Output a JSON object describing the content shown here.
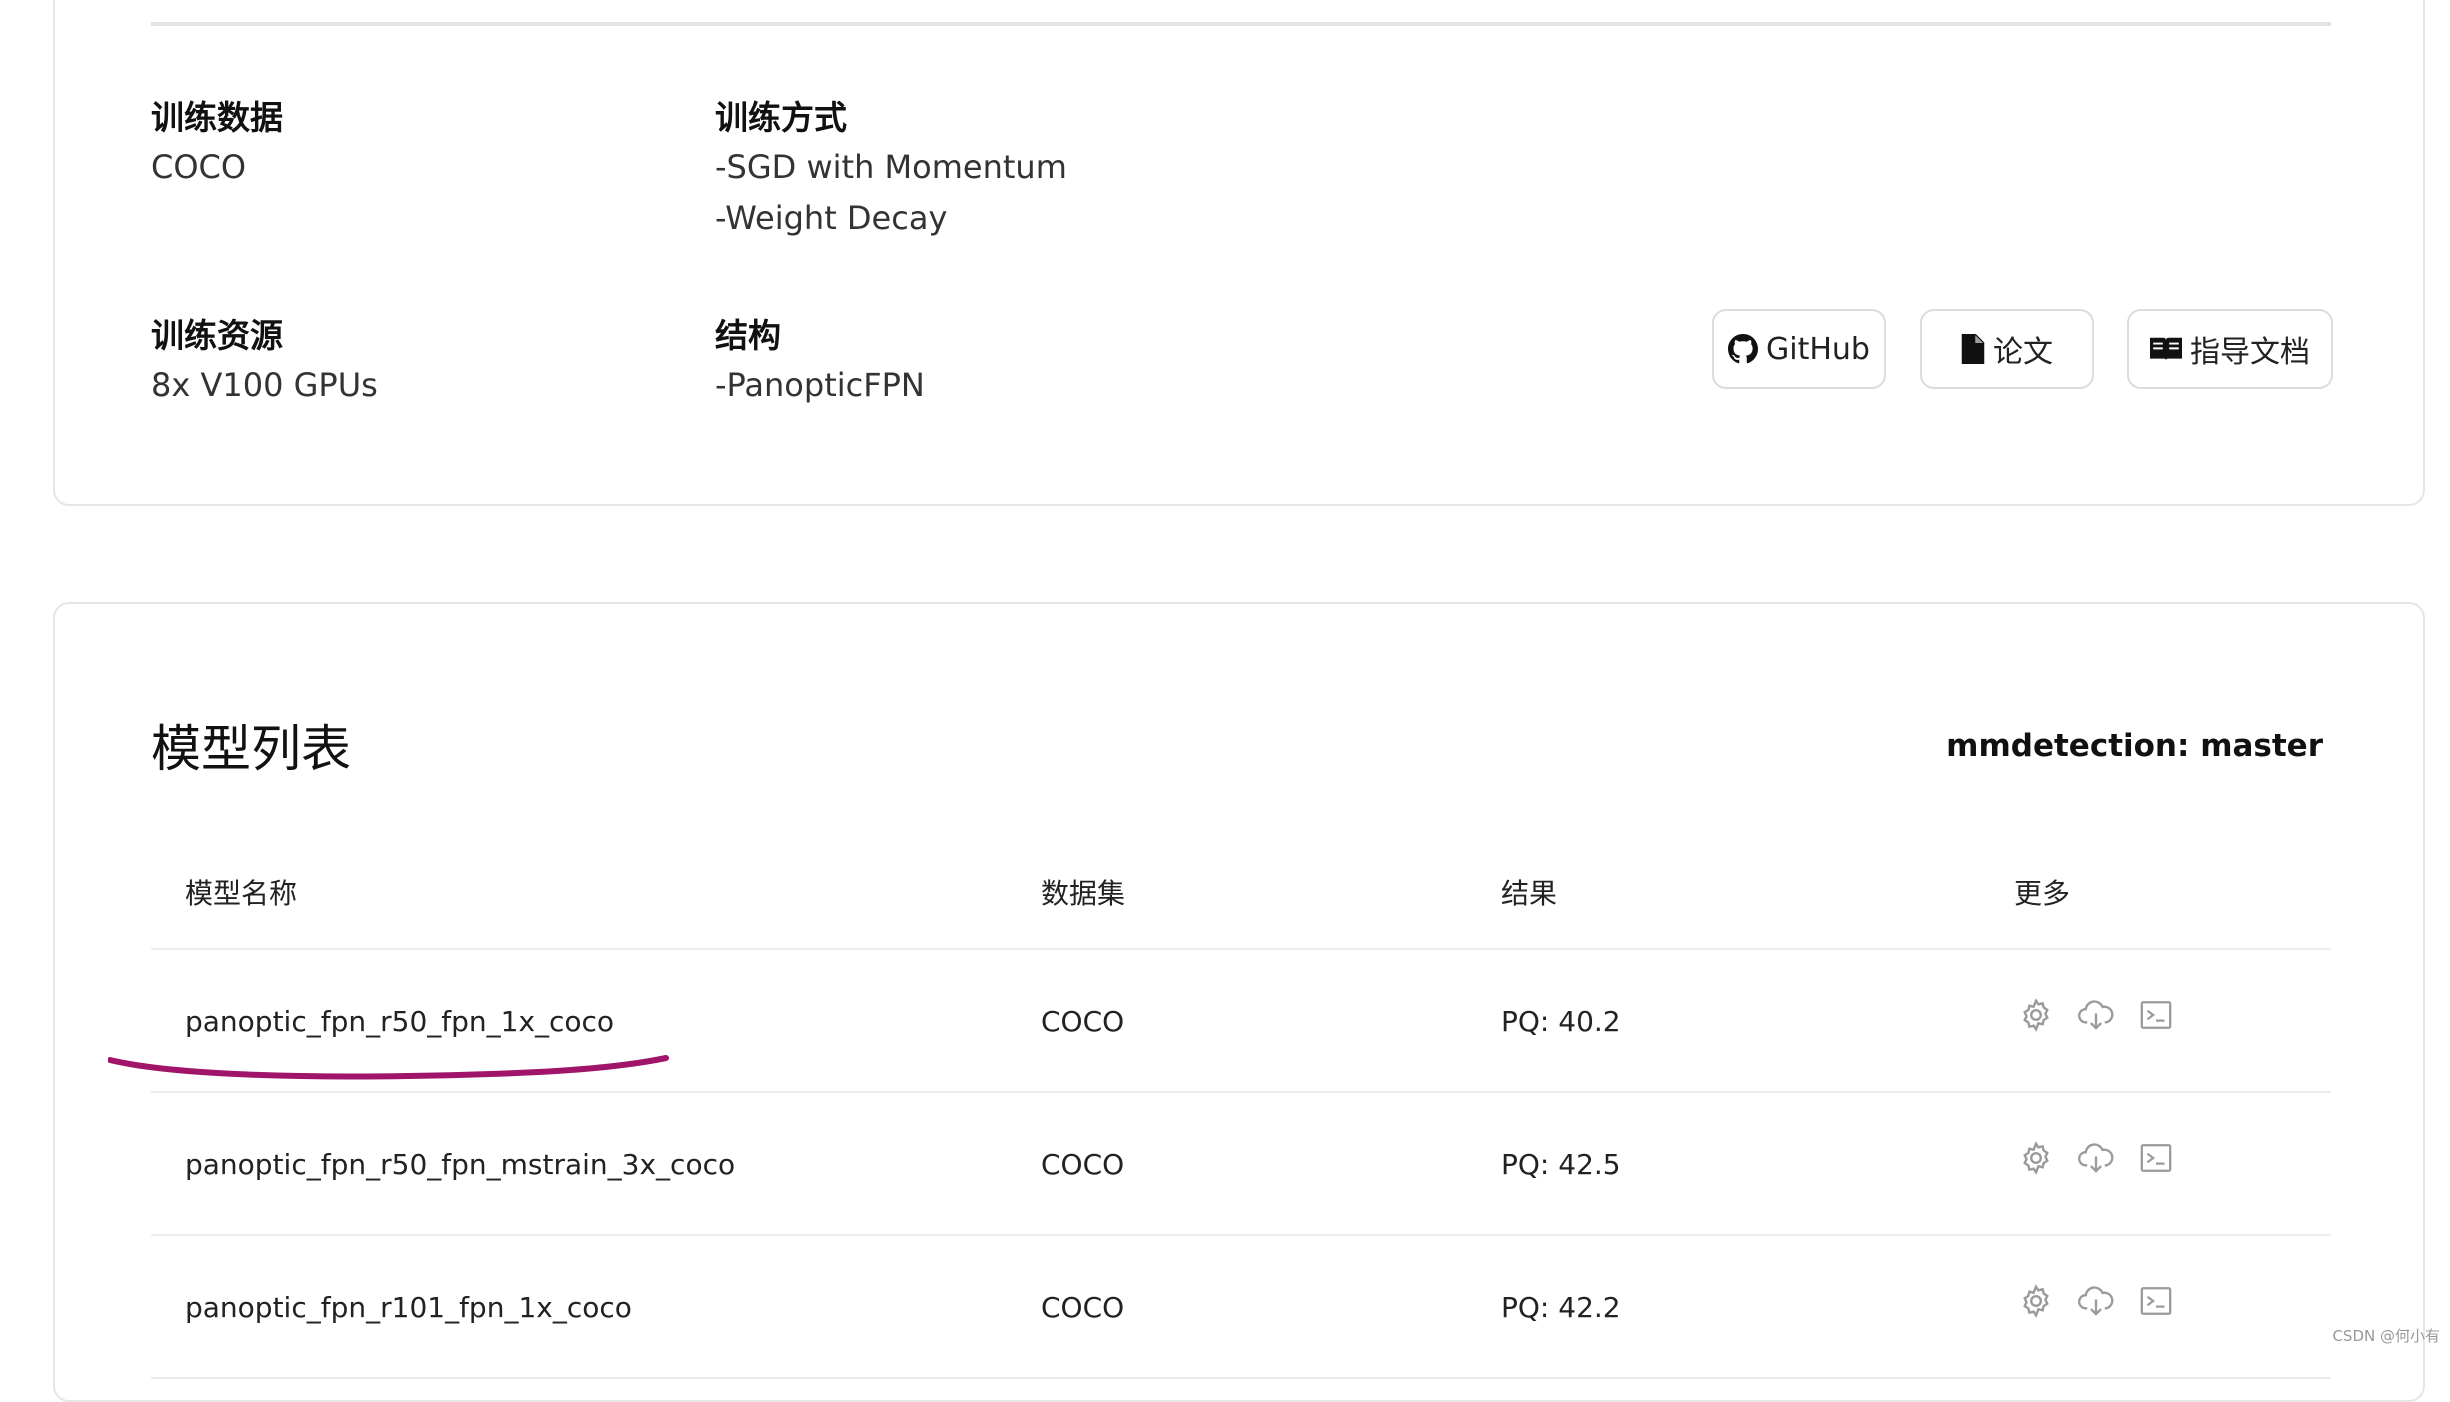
{
  "info": {
    "training_data": {
      "label": "训练数据",
      "values": [
        "COCO"
      ]
    },
    "training_method": {
      "label": "训练方式",
      "values": [
        "-SGD with Momentum",
        "-Weight Decay"
      ]
    },
    "training_resources": {
      "label": "训练资源",
      "values": [
        "8x V100 GPUs"
      ]
    },
    "architecture": {
      "label": "结构",
      "values": [
        "-PanopticFPN"
      ]
    }
  },
  "buttons": {
    "github": "GitHub",
    "paper": "论文",
    "docs": "指导文档"
  },
  "model_list": {
    "title": "模型列表",
    "branch": "mmdetection: master",
    "columns": [
      "模型名称",
      "数据集",
      "结果",
      "更多"
    ],
    "rows": [
      {
        "name": "panoptic_fpn_r50_fpn_1x_coco",
        "dataset": "COCO",
        "result": "PQ: 40.2"
      },
      {
        "name": "panoptic_fpn_r50_fpn_mstrain_3x_coco",
        "dataset": "COCO",
        "result": "PQ: 42.5"
      },
      {
        "name": "panoptic_fpn_r101_fpn_1x_coco",
        "dataset": "COCO",
        "result": "PQ: 42.2"
      }
    ]
  },
  "icons": {
    "row_actions": [
      "gear-icon",
      "cloud-download-icon",
      "terminal-icon"
    ],
    "github": "github-icon",
    "paper": "file-icon",
    "docs": "book-icon"
  },
  "colors": {
    "annotation_stroke": "#a0156a",
    "icon_gray": "#9a9a9a"
  },
  "watermark": "CSDN @何小有"
}
